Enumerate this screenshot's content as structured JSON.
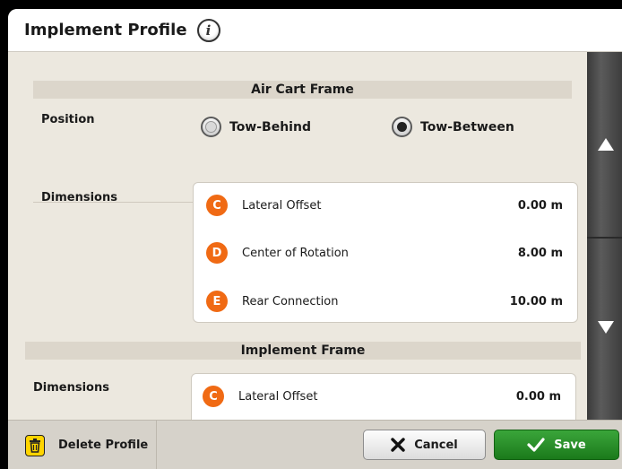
{
  "header": {
    "title": "Implement Profile",
    "info_icon": "info-icon"
  },
  "air_cart_frame": {
    "section_title": "Air Cart Frame",
    "position_label": "Position",
    "options": [
      {
        "label": "Tow-Behind",
        "selected": false
      },
      {
        "label": "Tow-Between",
        "selected": true
      }
    ],
    "dimensions_label": "Dimensions",
    "dimensions": [
      {
        "badge": "C",
        "label": "Lateral Offset",
        "value": "0.00 m"
      },
      {
        "badge": "D",
        "label": "Center of Rotation",
        "value": "8.00 m"
      },
      {
        "badge": "E",
        "label": "Rear Connection",
        "value": "10.00 m"
      }
    ]
  },
  "implement_frame": {
    "section_title": "Implement Frame",
    "dimensions_label": "Dimensions",
    "dimensions": [
      {
        "badge": "C",
        "label": "Lateral Offset",
        "value": "0.00 m"
      }
    ]
  },
  "footer": {
    "delete_label": "Delete Profile",
    "cancel_label": "Cancel",
    "save_label": "Save"
  },
  "colors": {
    "badge": "#f06a14",
    "save_button": "#2a8f2a",
    "trash_icon": "#ffd400"
  }
}
